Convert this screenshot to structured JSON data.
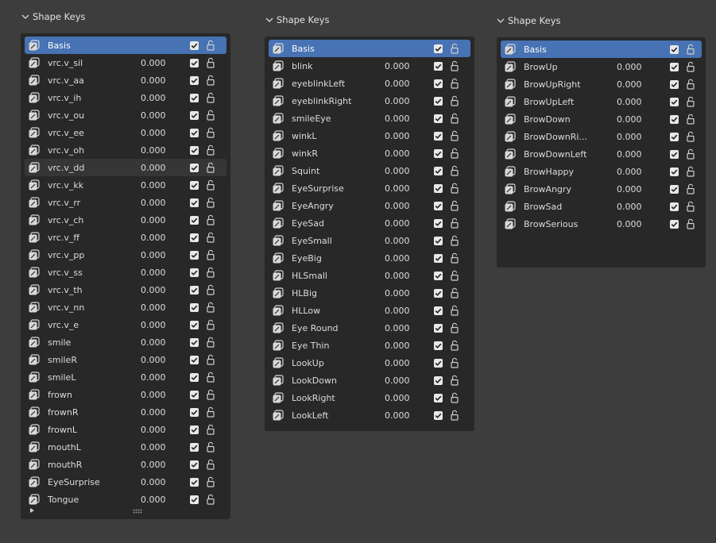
{
  "panels": [
    {
      "header": "Shape Keys",
      "keys": [
        {
          "name": "Basis",
          "value": "",
          "state": "selected"
        },
        {
          "name": "vrc.v_sil",
          "value": "0.000"
        },
        {
          "name": "vrc.v_aa",
          "value": "0.000"
        },
        {
          "name": "vrc.v_ih",
          "value": "0.000"
        },
        {
          "name": "vrc.v_ou",
          "value": "0.000"
        },
        {
          "name": "vrc.v_ee",
          "value": "0.000"
        },
        {
          "name": "vrc.v_oh",
          "value": "0.000"
        },
        {
          "name": "vrc.v_dd",
          "value": "0.000",
          "state": "hover"
        },
        {
          "name": "vrc.v_kk",
          "value": "0.000"
        },
        {
          "name": "vrc.v_rr",
          "value": "0.000"
        },
        {
          "name": "vrc.v_ch",
          "value": "0.000"
        },
        {
          "name": "vrc.v_ff",
          "value": "0.000"
        },
        {
          "name": "vrc.v_pp",
          "value": "0.000"
        },
        {
          "name": "vrc.v_ss",
          "value": "0.000"
        },
        {
          "name": "vrc.v_th",
          "value": "0.000"
        },
        {
          "name": "vrc.v_nn",
          "value": "0.000"
        },
        {
          "name": "vrc.v_e",
          "value": "0.000"
        },
        {
          "name": "smile",
          "value": "0.000"
        },
        {
          "name": "smileR",
          "value": "0.000"
        },
        {
          "name": "smileL",
          "value": "0.000"
        },
        {
          "name": "frown",
          "value": "0.000"
        },
        {
          "name": "frownR",
          "value": "0.000"
        },
        {
          "name": "frownL",
          "value": "0.000"
        },
        {
          "name": "mouthL",
          "value": "0.000"
        },
        {
          "name": "mouthR",
          "value": "0.000"
        },
        {
          "name": "EyeSurprise",
          "value": "0.000"
        },
        {
          "name": "Tongue",
          "value": "0.000"
        }
      ],
      "has_footer": true
    },
    {
      "header": "Shape Keys",
      "keys": [
        {
          "name": "Basis",
          "value": "",
          "state": "selected"
        },
        {
          "name": "blink",
          "value": "0.000"
        },
        {
          "name": "eyeblinkLeft",
          "value": "0.000"
        },
        {
          "name": "eyeblinkRight",
          "value": "0.000"
        },
        {
          "name": "smileEye",
          "value": "0.000"
        },
        {
          "name": "winkL",
          "value": "0.000"
        },
        {
          "name": "winkR",
          "value": "0.000"
        },
        {
          "name": "Squint",
          "value": "0.000"
        },
        {
          "name": "EyeSurprise",
          "value": "0.000"
        },
        {
          "name": "EyeAngry",
          "value": "0.000"
        },
        {
          "name": "EyeSad",
          "value": "0.000"
        },
        {
          "name": "EyeSmall",
          "value": "0.000"
        },
        {
          "name": "EyeBig",
          "value": "0.000"
        },
        {
          "name": "HLSmall",
          "value": "0.000"
        },
        {
          "name": "HLBig",
          "value": "0.000"
        },
        {
          "name": "HLLow",
          "value": "0.000"
        },
        {
          "name": "Eye Round",
          "value": "0.000"
        },
        {
          "name": "Eye Thin",
          "value": "0.000"
        },
        {
          "name": "LookUp",
          "value": "0.000"
        },
        {
          "name": "LookDown",
          "value": "0.000"
        },
        {
          "name": "LookRight",
          "value": "0.000"
        },
        {
          "name": "LookLeft",
          "value": "0.000"
        }
      ],
      "has_footer": false
    },
    {
      "header": "Shape Keys",
      "keys": [
        {
          "name": "Basis",
          "value": "",
          "state": "selected"
        },
        {
          "name": "BrowUp",
          "value": "0.000"
        },
        {
          "name": "BrowUpRight",
          "value": "0.000"
        },
        {
          "name": "BrowUpLeft",
          "value": "0.000"
        },
        {
          "name": "BrowDown",
          "value": "0.000"
        },
        {
          "name": "BrowDownRi...",
          "value": "0.000"
        },
        {
          "name": "BrowDownLeft",
          "value": "0.000"
        },
        {
          "name": "BrowHappy",
          "value": "0.000"
        },
        {
          "name": "BrowAngry",
          "value": "0.000"
        },
        {
          "name": "BrowSad",
          "value": "0.000"
        },
        {
          "name": "BrowSerious",
          "value": "0.000"
        }
      ],
      "has_footer": false
    }
  ],
  "icons": {
    "collapse": "chevron-down-icon",
    "shape_key": "shape-key-icon",
    "mute_checkbox": "checkbox-checked-icon",
    "lock": "unlock-icon",
    "expand_triangle": "triangle-right-icon",
    "resize_grip": "grip-icon"
  },
  "colors": {
    "background": "#3d3d3d",
    "list_background": "#282828",
    "selected_row": "#4772b3",
    "text": "#dcdcdc"
  }
}
